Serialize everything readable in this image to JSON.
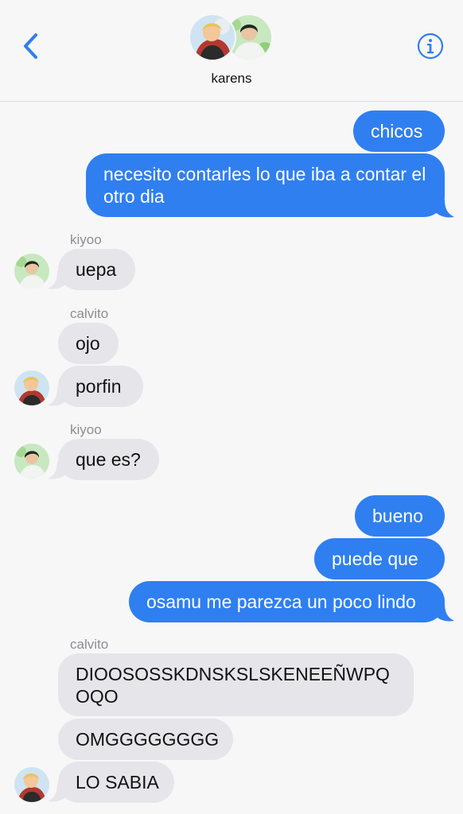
{
  "header": {
    "group_name": "karens"
  },
  "senders": {
    "kiyoo": "kiyoo",
    "calvito": "calvito"
  },
  "messages": [
    {
      "text": "chicos"
    },
    {
      "text": "necesito contarles lo que iba a contar el otro dia"
    },
    {
      "text": "uepa"
    },
    {
      "text": "ojo"
    },
    {
      "text": "porfin"
    },
    {
      "text": "que es?"
    },
    {
      "text": "bueno"
    },
    {
      "text": "puede que"
    },
    {
      "text": "osamu me parezca un poco lindo"
    },
    {
      "text": "DIOOSOSSKDNSKSLSKENEEÑWPQOQO"
    },
    {
      "text": "OMGGGGGGGG"
    },
    {
      "text": "LO SABIA"
    }
  ],
  "colors": {
    "outgoing": "#2f7ff0",
    "incoming": "#e6e5ea",
    "accent": "#2f7ff0"
  },
  "icons": {
    "back": "chevron-left-icon",
    "info": "info-icon"
  }
}
